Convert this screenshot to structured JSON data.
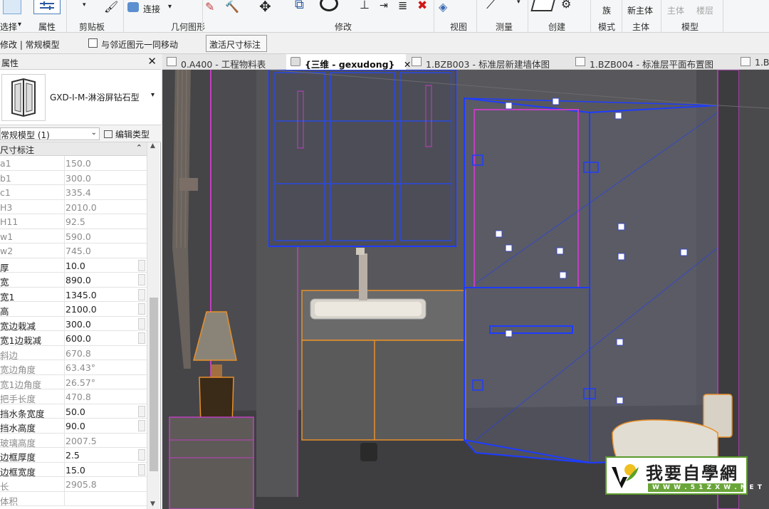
{
  "ribbon": {
    "items": {
      "select": "选择",
      "select_arrow": "▾",
      "properties": "属性",
      "connect": "连接",
      "connect_arrow": "▾",
      "family": "族",
      "new_host": "新主体",
      "host": "主体",
      "level": "楼层"
    },
    "groups": {
      "clipboard": "剪贴板",
      "geometry": "几何图形",
      "modify": "修改",
      "view": "视图",
      "measure": "测量",
      "create": "创建",
      "mode": "模式",
      "host": "主体",
      "model": "模型"
    }
  },
  "options_bar": {
    "context_label": "修改 | 常规模型",
    "move_with_nearby": "与邻近图元一同移动",
    "activate_dimensions": "激活尺寸标注"
  },
  "properties_panel": {
    "title": "属性",
    "close": "✕",
    "type_name": "GXD-I-M-淋浴屏钻石型",
    "type_arrow": "▾",
    "instance_filter": "常规模型 (1)",
    "edit_type": "编辑类型",
    "section_title": "尺寸标注",
    "section_chevron": "⌃",
    "rows": [
      {
        "name": "a1",
        "value": "150.0",
        "editable": false
      },
      {
        "name": "b1",
        "value": "300.0",
        "editable": false
      },
      {
        "name": "c1",
        "value": "335.4",
        "editable": false
      },
      {
        "name": "H3",
        "value": "2010.0",
        "editable": false
      },
      {
        "name": "H11",
        "value": "92.5",
        "editable": false
      },
      {
        "name": "w1",
        "value": "590.0",
        "editable": false
      },
      {
        "name": "w2",
        "value": "745.0",
        "editable": false
      },
      {
        "name": "厚",
        "value": "10.0",
        "editable": true
      },
      {
        "name": "宽",
        "value": "890.0",
        "editable": true
      },
      {
        "name": "宽1",
        "value": "1345.0",
        "editable": true
      },
      {
        "name": "高",
        "value": "2100.0",
        "editable": true
      },
      {
        "name": "宽边栽减",
        "value": "300.0",
        "editable": true
      },
      {
        "name": "宽1边栽减",
        "value": "600.0",
        "editable": true
      },
      {
        "name": "斜边",
        "value": "670.8",
        "editable": false
      },
      {
        "name": "宽边角度",
        "value": "63.43°",
        "editable": false
      },
      {
        "name": "宽1边角度",
        "value": "26.57°",
        "editable": false
      },
      {
        "name": "把手长度",
        "value": "470.8",
        "editable": false
      },
      {
        "name": "挡水条宽度",
        "value": "50.0",
        "editable": true
      },
      {
        "name": "挡水高度",
        "value": "90.0",
        "editable": true
      },
      {
        "name": "玻璃高度",
        "value": "2007.5",
        "editable": false
      },
      {
        "name": "边框厚度",
        "value": "2.5",
        "editable": true
      },
      {
        "name": "边框宽度",
        "value": "15.0",
        "editable": true
      },
      {
        "name": "长",
        "value": "2905.8",
        "editable": false
      },
      {
        "name": "体积",
        "value": "",
        "editable": false
      }
    ]
  },
  "tabs": [
    {
      "label": "0.A400 - 工程物料表",
      "active": false
    },
    {
      "label": "{三维 - gexudong}",
      "active": true,
      "close": "✕"
    },
    {
      "label": "1.BZB003 - 标准层新建墙体图",
      "active": false
    },
    {
      "label": "1.BZB004 - 标准层平面布置图",
      "active": false
    },
    {
      "label": "1.B",
      "active": false
    }
  ],
  "watermark": {
    "text": "我要自學網",
    "url": "W W W . 5 1 Z X W . N E T"
  },
  "colors": {
    "selection_blue": "#1e3cff",
    "highlight_magenta": "#c040c0",
    "orange_edges": "#e8902a",
    "watermark_green": "#5a9a2a"
  }
}
